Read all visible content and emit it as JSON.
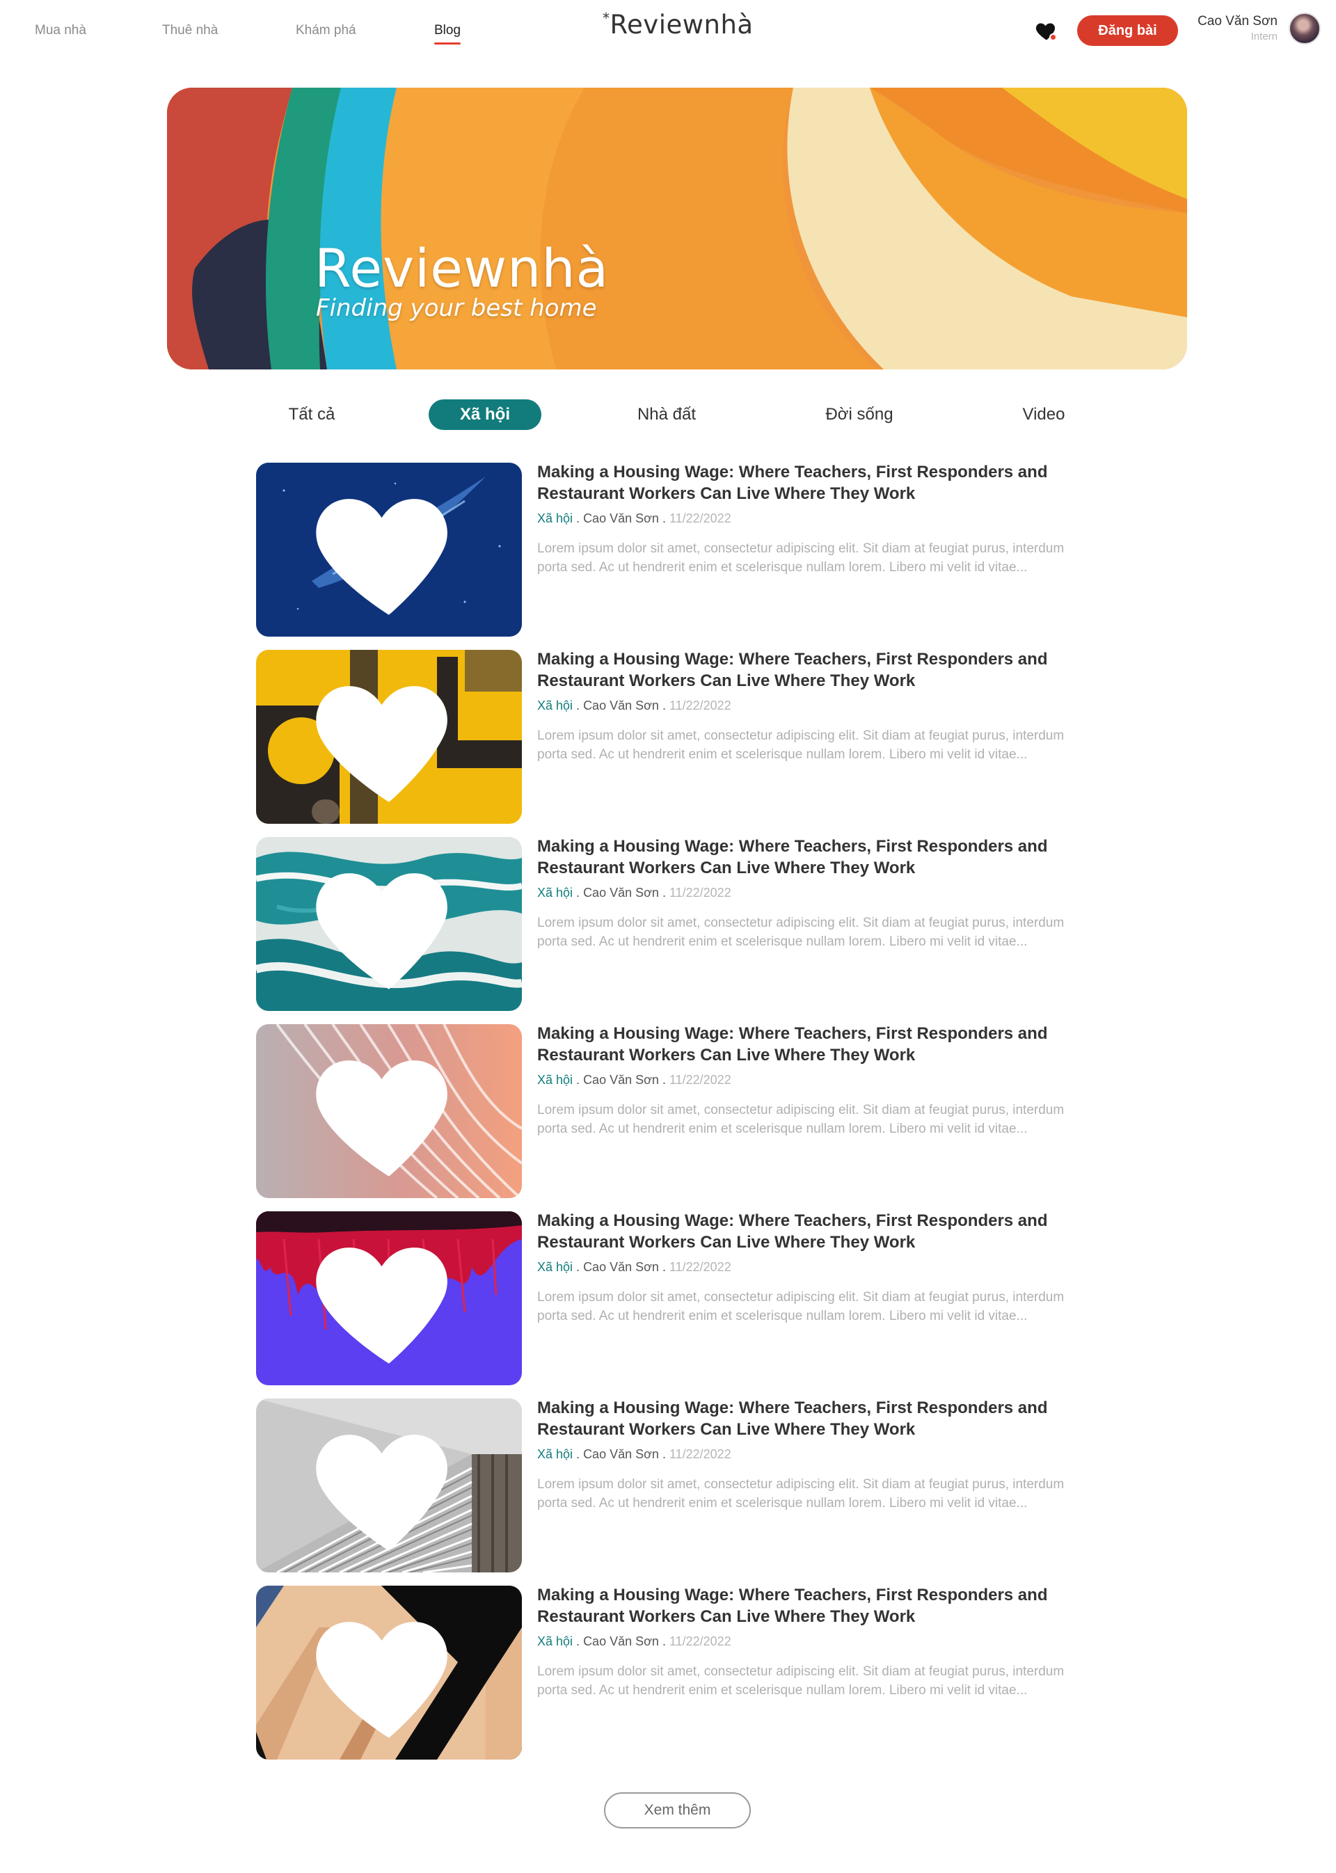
{
  "header": {
    "nav": [
      {
        "label": "Mua nhà",
        "active": false
      },
      {
        "label": "Thuê nhà",
        "active": false
      },
      {
        "label": "Khám phá",
        "active": false
      },
      {
        "label": "Blog",
        "active": true
      }
    ],
    "logo_mark": "*",
    "logo_text": "Reviewnhà",
    "favorites_icon": "heart-icon",
    "post_button": "Đăng bài",
    "user": {
      "name": "Cao Văn Sơn",
      "role": "Intern"
    }
  },
  "banner": {
    "title": "Reviewnhà",
    "subtitle": "Finding your best home"
  },
  "tabs": [
    {
      "label": "Tất cả",
      "active": false
    },
    {
      "label": "Xã hội",
      "active": true
    },
    {
      "label": "Nhà đất",
      "active": false
    },
    {
      "label": "Đời sống",
      "active": false
    },
    {
      "label": "Video",
      "active": false
    }
  ],
  "articles": [
    {
      "title": "Making a Housing Wage: Where Teachers, First Responders and Restaurant Workers Can Live Where They Work",
      "category": "Xã hội",
      "author": "Cao Văn Sơn",
      "date": "11/22/2022",
      "excerpt": "Lorem ipsum dolor sit amet, consectetur adipiscing elit. Sit diam at feugiat purus, interdum porta sed. Ac ut hendrerit enim et scelerisque nullam lorem. Libero mi velit id vitae...",
      "image": "blue-starfield"
    },
    {
      "title": "Making a Housing Wage: Where Teachers, First Responders and Restaurant Workers Can Live Where They Work",
      "category": "Xã hội",
      "author": "Cao Văn Sơn",
      "date": "11/22/2022",
      "excerpt": "Lorem ipsum dolor sit amet, consectetur adipiscing elit. Sit diam at feugiat purus, interdum porta sed. Ac ut hendrerit enim et scelerisque nullam lorem. Libero mi velit id vitae...",
      "image": "yellow-grunge"
    },
    {
      "title": "Making a Housing Wage: Where Teachers, First Responders and Restaurant Workers Can Live Where They Work",
      "category": "Xã hội",
      "author": "Cao Văn Sơn",
      "date": "11/22/2022",
      "excerpt": "Lorem ipsum dolor sit amet, consectetur adipiscing elit. Sit diam at feugiat purus, interdum porta sed. Ac ut hendrerit enim et scelerisque nullam lorem. Libero mi velit id vitae...",
      "image": "teal-marble"
    },
    {
      "title": "Making a Housing Wage: Where Teachers, First Responders and Restaurant Workers Can Live Where They Work",
      "category": "Xã hội",
      "author": "Cao Văn Sơn",
      "date": "11/22/2022",
      "excerpt": "Lorem ipsum dolor sit amet, consectetur adipiscing elit. Sit diam at feugiat purus, interdum porta sed. Ac ut hendrerit enim et scelerisque nullam lorem. Libero mi velit id vitae...",
      "image": "peach-curves"
    },
    {
      "title": "Making a Housing Wage: Where Teachers, First Responders and Restaurant Workers Can Live Where They Work",
      "category": "Xã hội",
      "author": "Cao Văn Sơn",
      "date": "11/22/2022",
      "excerpt": "Lorem ipsum dolor sit amet, consectetur adipiscing elit. Sit diam at feugiat purus, interdum porta sed. Ac ut hendrerit enim et scelerisque nullam lorem. Libero mi velit id vitae...",
      "image": "red-plant-on-purple"
    },
    {
      "title": "Making a Housing Wage: Where Teachers, First Responders and Restaurant Workers Can Live Where They Work",
      "category": "Xã hội",
      "author": "Cao Văn Sơn",
      "date": "11/22/2022",
      "excerpt": "Lorem ipsum dolor sit amet, consectetur adipiscing elit. Sit diam at feugiat purus, interdum porta sed. Ac ut hendrerit enim et scelerisque nullam lorem. Libero mi velit id vitae...",
      "image": "grey-stairs"
    },
    {
      "title": "Making a Housing Wage: Where Teachers, First Responders and Restaurant Workers Can Live Where They Work",
      "category": "Xã hội",
      "author": "Cao Văn Sơn",
      "date": "11/22/2022",
      "excerpt": "Lorem ipsum dolor sit amet, consectetur adipiscing elit. Sit diam at feugiat purus, interdum porta sed. Ac ut hendrerit enim et scelerisque nullam lorem. Libero mi velit id vitae...",
      "image": "beige-architecture"
    }
  ],
  "meta_separator": " . ",
  "more_button": "Xem thêm",
  "colors": {
    "accent_red": "#d93b2b",
    "accent_teal": "#127c7c",
    "muted_text": "#b0b0b0"
  }
}
